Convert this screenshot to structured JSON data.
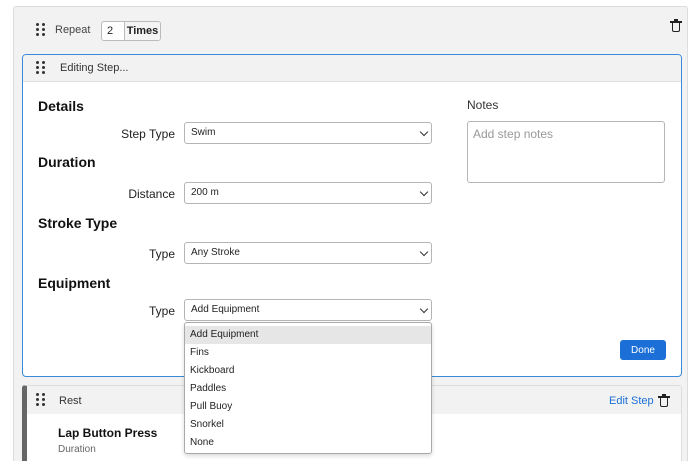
{
  "repeat": {
    "label": "Repeat",
    "count": "2",
    "unit": "Times"
  },
  "editing": {
    "title": "Editing Step...",
    "details": {
      "heading": "Details",
      "step_type_label": "Step Type",
      "step_type_value": "Swim"
    },
    "duration": {
      "heading": "Duration",
      "distance_label": "Distance",
      "distance_value": "200 m"
    },
    "stroke": {
      "heading": "Stroke Type",
      "type_label": "Type",
      "type_value": "Any Stroke"
    },
    "equipment": {
      "heading": "Equipment",
      "type_label": "Type",
      "type_value": "Add Equipment",
      "options": [
        "Add Equipment",
        "Fins",
        "Kickboard",
        "Paddles",
        "Pull Buoy",
        "Snorkel",
        "None"
      ]
    },
    "notes": {
      "label": "Notes",
      "placeholder": "Add step notes"
    },
    "done_label": "Done"
  },
  "rest": {
    "title": "Rest",
    "edit_label": "Edit Step",
    "lap": "Lap Button Press",
    "duration_label": "Duration"
  },
  "colors": {
    "accent": "#1b6fd6",
    "active_border": "#3a8ad9"
  }
}
